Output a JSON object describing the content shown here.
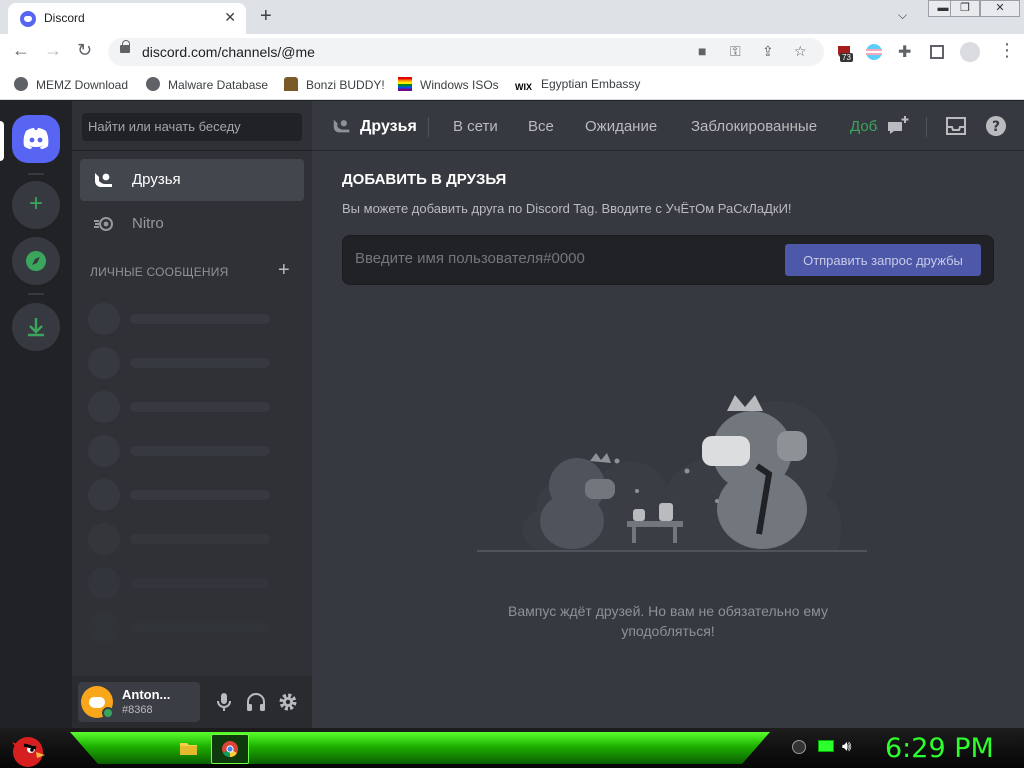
{
  "browser": {
    "tab_title": "Discord",
    "url": "discord.com/channels/@me",
    "extension_badge": "73",
    "bookmarks": [
      {
        "label": "MEMZ Download",
        "icon": "globe-icon"
      },
      {
        "label": "Malware Database",
        "icon": "globe-icon"
      },
      {
        "label": "Bonzi BUDDY!",
        "icon": "bonzi-icon"
      },
      {
        "label": "Windows ISOs",
        "icon": "rainbow-flag-icon"
      },
      {
        "label": "Egyptian Embassy",
        "icon": "wix-icon"
      }
    ]
  },
  "sidebar": {
    "search_placeholder": "Найти или начать беседу",
    "friends_label": "Друзья",
    "nitro_label": "Nitro",
    "dm_header": "ЛИЧНЫЕ СООБЩЕНИЯ",
    "dm_add": "+"
  },
  "user": {
    "name": "Anton...",
    "tag": "#8368"
  },
  "topbar": {
    "title": "Друзья",
    "tabs": [
      "В сети",
      "Все",
      "Ожидание",
      "Заблокированные"
    ],
    "add_friend": "Добавить в друзья"
  },
  "add_friend": {
    "title": "ДОБАВИТЬ В ДРУЗЬЯ",
    "description": "Вы можете добавить друга по Discord Tag. Вводите с УчЁтОм РаСкЛаДкИ!",
    "input_placeholder": "Введите имя пользователя#0000",
    "button_label": "Отправить запрос дружбы"
  },
  "empty_state": {
    "text": "Вампус ждёт друзей. Но вам не обязательно ему уподобляться!"
  },
  "taskbar": {
    "clock": "6:29 PM"
  },
  "colors": {
    "discord_blurple": "#5865f2",
    "discord_green": "#3ba55d",
    "taskbar_green": "#2cff2c"
  }
}
